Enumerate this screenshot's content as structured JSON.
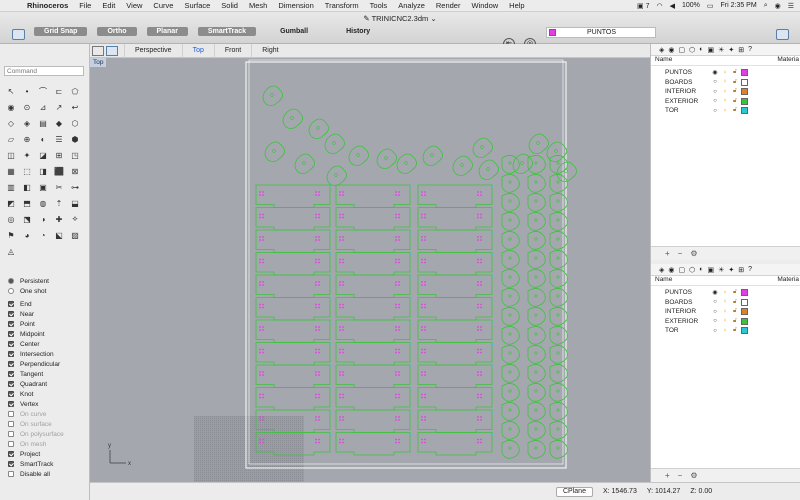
{
  "menubar": {
    "app": "Rhinoceros",
    "items": [
      "File",
      "Edit",
      "View",
      "Curve",
      "Surface",
      "Solid",
      "Mesh",
      "Dimension",
      "Transform",
      "Tools",
      "Analyze",
      "Render",
      "Window",
      "Help"
    ],
    "status": {
      "notifications": "7",
      "battery": "100%",
      "clock": "Fri 2:35 PM"
    }
  },
  "titlebar": {
    "document": "TRINICNC2.3dm",
    "buttons": [
      "Grid Snap",
      "Ortho",
      "Planar",
      "SmartTrack"
    ],
    "plain_buttons": [
      "Gumball",
      "History"
    ],
    "current_layer": "PUNTOS",
    "current_layer_color": "#e040e0"
  },
  "viewport_tabs": [
    "Perspective",
    "Top",
    "Front",
    "Right"
  ],
  "active_tab": "Top",
  "viewport": {
    "label": "Top",
    "axis_x": "x",
    "axis_y": "y"
  },
  "command": {
    "placeholder": "Command"
  },
  "tools": [
    "↖",
    "•",
    "⌒",
    "⊏",
    "⬠",
    "◉",
    "⊙",
    "⊿",
    "↗",
    "↩",
    "◇",
    "◈",
    "▤",
    "◆",
    "⬡",
    "▱",
    "⊕",
    "◐",
    "☰",
    "⬢",
    "◫",
    "✦",
    "◪",
    "⊞",
    "◳",
    "▦",
    "⬚",
    "◨",
    "⬛",
    "⊠",
    "▥",
    "◧",
    "▣",
    "✂",
    "⊶",
    "◩",
    "⬒",
    "◍",
    "⇡",
    "⬓",
    "◎",
    "⬔",
    "◑",
    "✚",
    "⟡",
    "⚑",
    "◕",
    "◔",
    "⬕",
    "▨",
    "◬"
  ],
  "osnaps": {
    "modes": [
      {
        "label": "Persistent",
        "on": true
      },
      {
        "label": "One shot",
        "on": false
      }
    ],
    "items": [
      {
        "label": "End",
        "on": true,
        "dim": false
      },
      {
        "label": "Near",
        "on": true,
        "dim": false
      },
      {
        "label": "Point",
        "on": true,
        "dim": false
      },
      {
        "label": "Midpoint",
        "on": true,
        "dim": false
      },
      {
        "label": "Center",
        "on": true,
        "dim": false
      },
      {
        "label": "Intersection",
        "on": true,
        "dim": false
      },
      {
        "label": "Perpendicular",
        "on": true,
        "dim": false
      },
      {
        "label": "Tangent",
        "on": true,
        "dim": false
      },
      {
        "label": "Quadrant",
        "on": true,
        "dim": false
      },
      {
        "label": "Knot",
        "on": true,
        "dim": false
      },
      {
        "label": "Vertex",
        "on": true,
        "dim": false
      },
      {
        "label": "On curve",
        "on": false,
        "dim": true
      },
      {
        "label": "On surface",
        "on": false,
        "dim": true
      },
      {
        "label": "On polysurface",
        "on": false,
        "dim": true
      },
      {
        "label": "On mesh",
        "on": false,
        "dim": true
      },
      {
        "label": "Project",
        "on": true,
        "dim": false
      },
      {
        "label": "SmartTrack",
        "on": true,
        "dim": false
      },
      {
        "label": "Disable all",
        "on": false,
        "dim": false
      }
    ]
  },
  "layers_panel": {
    "col_name": "Name",
    "col_material": "Materia",
    "layers": [
      {
        "name": "PUNTOS",
        "color": "#e040e0",
        "current": true
      },
      {
        "name": "BOARDS",
        "color": "#ffffff",
        "current": false
      },
      {
        "name": "INTERIOR",
        "color": "#e0802a",
        "current": false
      },
      {
        "name": "EXTERIOR",
        "color": "#3dc23d",
        "current": false
      },
      {
        "name": "TOR",
        "color": "#2ac8d0",
        "current": false
      }
    ]
  },
  "statusbar": {
    "cplane": "CPlane",
    "x": "X: 1546.73",
    "y": "Y: 1014.27",
    "z": "Z: 0.00"
  },
  "colors": {
    "viewport_bg": "#a4a8ae",
    "exterior_curve": "#3dc23d",
    "point": "#e040e0",
    "tor": "#2ac8d0",
    "board_outline": "#ffffff"
  }
}
